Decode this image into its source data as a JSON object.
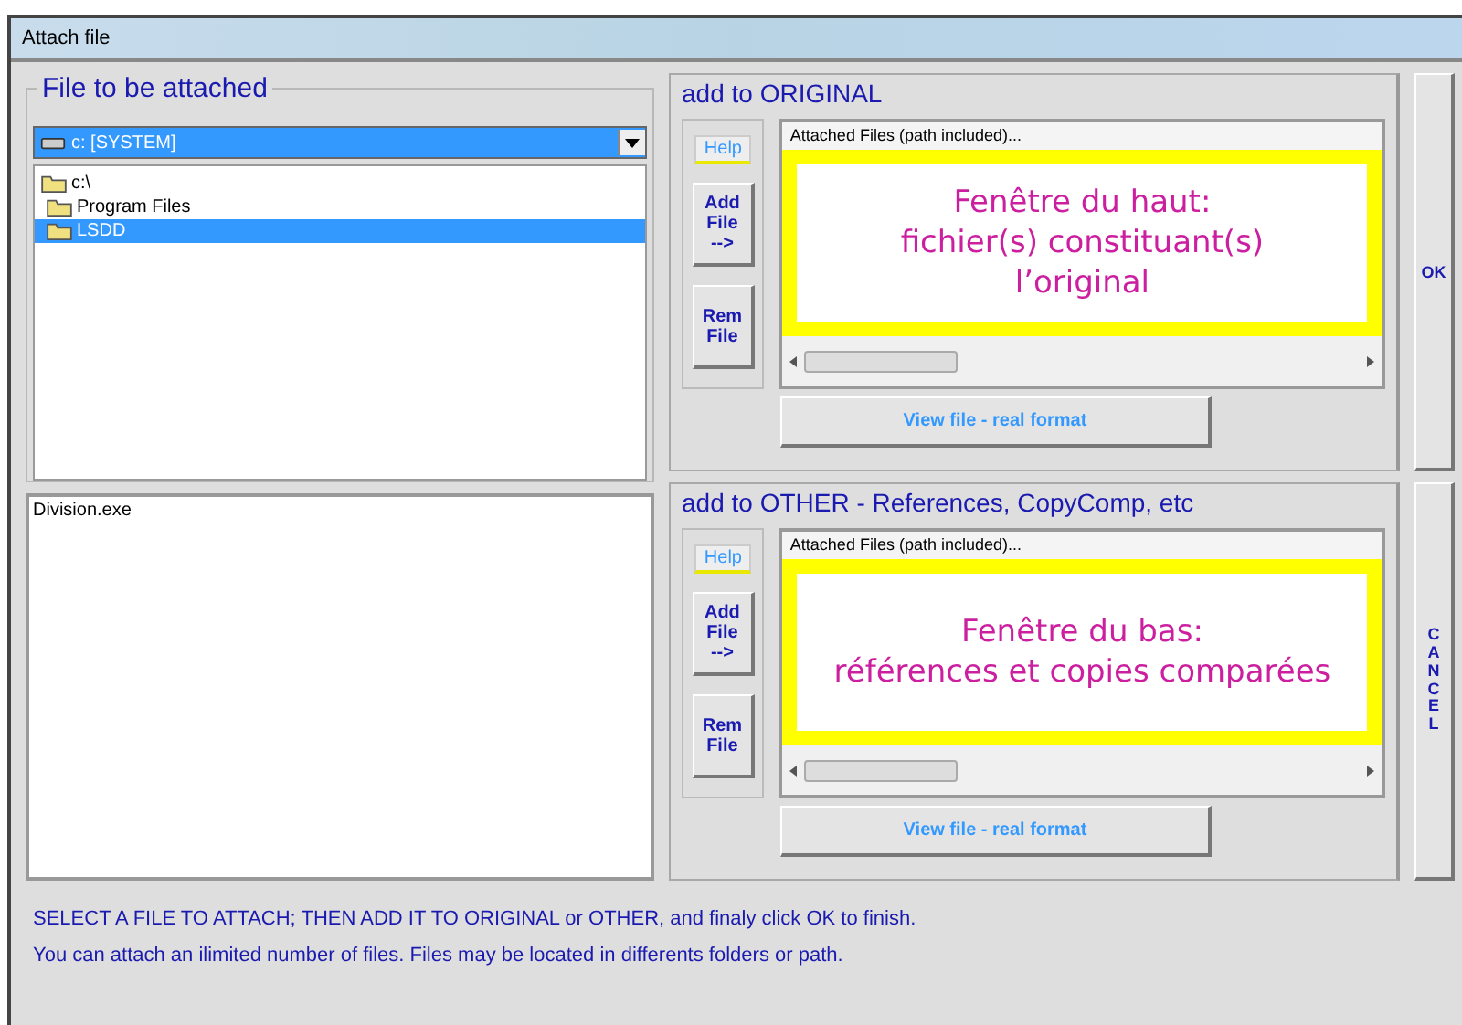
{
  "window": {
    "title": "Attach file"
  },
  "file_group": {
    "title": "File to be attached",
    "drive": "c: [SYSTEM]",
    "tree": [
      {
        "label": "c:\\",
        "selected": false,
        "children": [
          {
            "label": "Program Files",
            "selected": false
          },
          {
            "label": "LSDD",
            "selected": true
          }
        ]
      }
    ],
    "files": [
      "Division.exe"
    ]
  },
  "sections": [
    {
      "title": "add to ORIGINAL",
      "help": "Help",
      "add": "Add File -->",
      "rem": "Rem File",
      "list_header": "Attached Files (path included)...",
      "note": [
        "Fenêtre du haut:",
        "fichier(s) constituant(s)",
        "l’original"
      ],
      "view": "View file - real format"
    },
    {
      "title": "add to OTHER - References, CopyComp, etc",
      "help": "Help",
      "add": "Add File -->",
      "rem": "Rem File",
      "list_header": "Attached Files (path included)...",
      "note": [
        "Fenêtre du bas:",
        "références et copies comparées"
      ],
      "view": "View file - real format"
    }
  ],
  "ok": "OK",
  "cancel": "CANCEL",
  "instructions": [
    "SELECT A FILE TO ATTACH; THEN ADD IT TO ORIGINAL or OTHER, and finaly click OK to finish.",
    "You can attach an ilimited number of files. Files may be located in differents folders or path."
  ]
}
